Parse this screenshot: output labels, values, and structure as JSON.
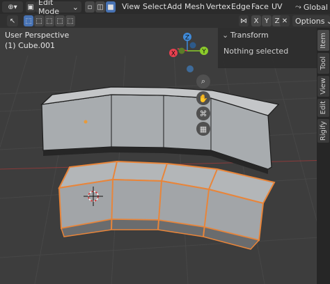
{
  "header": {
    "mode_label": "Edit Mode",
    "menus": [
      "View",
      "Select",
      "Add",
      "Mesh",
      "Vertex",
      "Edge",
      "Face",
      "UV"
    ],
    "transform_orientation": "Global"
  },
  "toolbar": {
    "axis_x": "X",
    "axis_y": "Y",
    "axis_z": "Z",
    "options_label": "Options"
  },
  "viewport": {
    "view_name": "User Perspective",
    "object_info": "(1) Cube.001"
  },
  "gizmo": {
    "x": "X",
    "y": "Y",
    "z": "Z"
  },
  "npanel": {
    "title": "Transform",
    "message": "Nothing selected",
    "tabs": [
      "Item",
      "Tool",
      "View",
      "Edit",
      "Rigify"
    ]
  },
  "colors": {
    "selection": "#e8853a",
    "axis_x": "#e8404f",
    "axis_y": "#8ccc2b",
    "axis_z": "#3f8ad9",
    "accent": "#4772b3"
  }
}
